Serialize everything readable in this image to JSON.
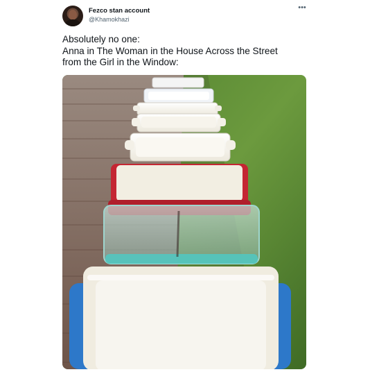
{
  "tweet": {
    "display_name": "Fezco stan account",
    "handle": "@Khamokhazi",
    "more_icon": "more-dots-icon",
    "text_lines": [
      "Absolutely no one:",
      "Anna in The Woman in the House Across the Street",
      "from the Girl in the Window:"
    ]
  },
  "photo": {
    "subject": "baking dishes in a row on a wooden deck beside grass",
    "colors": {
      "deck": "#8a7468",
      "grass": "#5f8f3a",
      "red_dish": "#c42633",
      "glass_dish": "#52c7c0",
      "blue_dish": "#2d78c9",
      "cream": "#f2eee2"
    }
  }
}
